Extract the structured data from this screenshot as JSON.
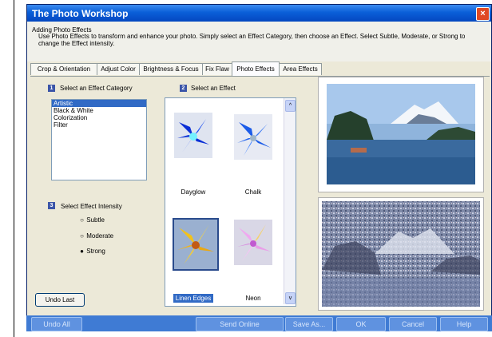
{
  "window": {
    "title": "The Photo Workshop",
    "close_glyph": "×"
  },
  "header": {
    "title": "Adding Photo Effects",
    "description": "Use Photo Effects to transform and enhance your photo.  Simply select an Effect Category, then choose an Effect.  Select Subtle, Moderate, or Strong to change the Effect intensity."
  },
  "tabs": [
    {
      "label": "Crop & Orientation",
      "active": false
    },
    {
      "label": "Adjust Color",
      "active": false
    },
    {
      "label": "Brightness & Focus",
      "active": false
    },
    {
      "label": "Fix Flaw",
      "active": false
    },
    {
      "label": "Photo Effects",
      "active": true
    },
    {
      "label": "Area Effects",
      "active": false
    }
  ],
  "step1": {
    "number": "1",
    "label": "Select an Effect Category"
  },
  "step2": {
    "number": "2",
    "label": "Select an Effect"
  },
  "step3": {
    "number": "3",
    "label": "Select Effect Intensity"
  },
  "categories": [
    "Artistic",
    "Black & White",
    "Colorization",
    "Filter"
  ],
  "selected_category": "Artistic",
  "intensity": {
    "options": [
      "Subtle",
      "Moderate",
      "Strong"
    ],
    "selected": "Strong"
  },
  "effects": [
    {
      "name": "Dayglow",
      "selected": false
    },
    {
      "name": "Chalk",
      "selected": false
    },
    {
      "name": "Linen Edges",
      "selected": true
    },
    {
      "name": "Neon",
      "selected": false
    }
  ],
  "buttons": {
    "undo_last": "Undo Last",
    "undo_all": "Undo All",
    "send_online": "Send Online",
    "save_as": "Save As...",
    "ok": "OK",
    "cancel": "Cancel",
    "help": "Help"
  },
  "icons": {
    "scroll_up": "^",
    "scroll_down": "v",
    "radio_on": "●",
    "radio_off": "○"
  },
  "colors": {
    "titlebar": "#0a5fd8",
    "selection": "#316ac5",
    "bottombar": "#3f7bd4"
  }
}
